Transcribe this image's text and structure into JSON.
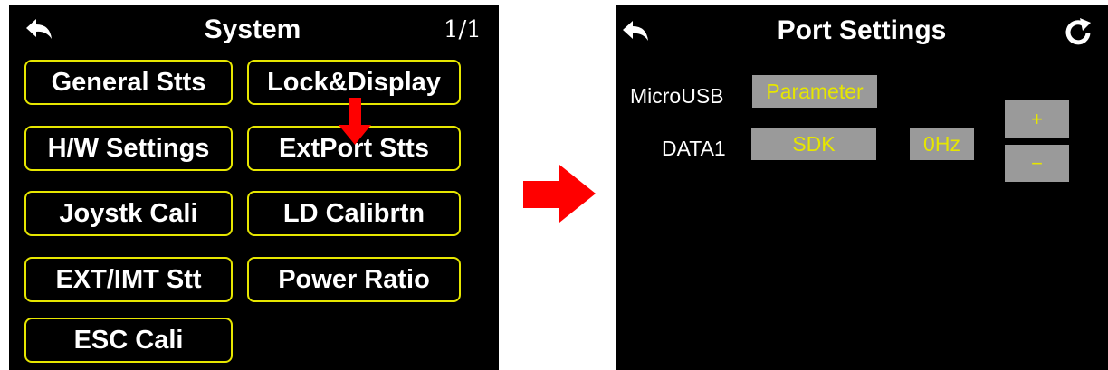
{
  "system": {
    "title": "System",
    "page": "1/1",
    "buttons": [
      "General Stts",
      "Lock&Display",
      "H/W Settings",
      "ExtPort Stts",
      "Joystk Cali",
      "LD Calibrtn",
      "EXT/IMT Stt",
      "Power Ratio",
      "ESC Cali"
    ]
  },
  "port_settings": {
    "title": "Port Settings",
    "microusb_label": "MicroUSB",
    "microusb_value": "Parameter",
    "data1_label": "DATA1",
    "data1_value": "SDK",
    "data1_rate": "0Hz",
    "plus": "+",
    "minus": "−"
  },
  "colors": {
    "accent_yellow": "#e6e600",
    "field_gray": "#9a9a9a",
    "arrow_red": "#ff0000"
  },
  "icons": [
    "back-icon",
    "refresh-icon",
    "arrow-down-icon",
    "arrow-right-icon"
  ]
}
